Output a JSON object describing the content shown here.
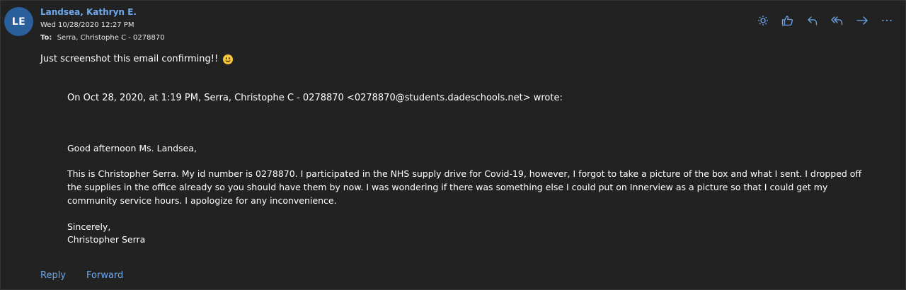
{
  "message": {
    "avatar_initials": "LE",
    "sender": "Landsea, Kathryn E.",
    "date": "Wed 10/28/2020 12:27 PM",
    "to_label": "To:",
    "to_value": "Serra, Christophe C - 0278870",
    "body_text": "Just screenshot this email confirming!!",
    "body_emoji": "smiling-face-emoji"
  },
  "toolbar": {
    "icons": [
      "sun-icon",
      "thumbs-up-icon",
      "reply-icon",
      "reply-all-icon",
      "forward-icon",
      "more-icon"
    ]
  },
  "quoted": {
    "header": "On Oct 28, 2020, at 1:19 PM, Serra, Christophe C - 0278870 <0278870@students.dadeschools.net> wrote:",
    "greeting": "Good afternoon Ms. Landsea,",
    "paragraph": "This is Christopher Serra. My id number is 0278870. I participated in the NHS supply drive for Covid-19, however, I forgot to take a picture of the box and what I sent. I dropped off the supplies in the office already so you should have them by now. I was wondering if there was something else I could put on Innerview as a picture so that I could get my community service hours. I apologize for any inconvenience.",
    "closing": "Sincerely,",
    "signature": "Christopher Serra"
  },
  "footer": {
    "reply_label": "Reply",
    "forward_label": "Forward"
  },
  "colors": {
    "background": "#222222",
    "accent": "#6ea8ec",
    "avatar": "#2a5f9c",
    "text": "#ffffff"
  }
}
